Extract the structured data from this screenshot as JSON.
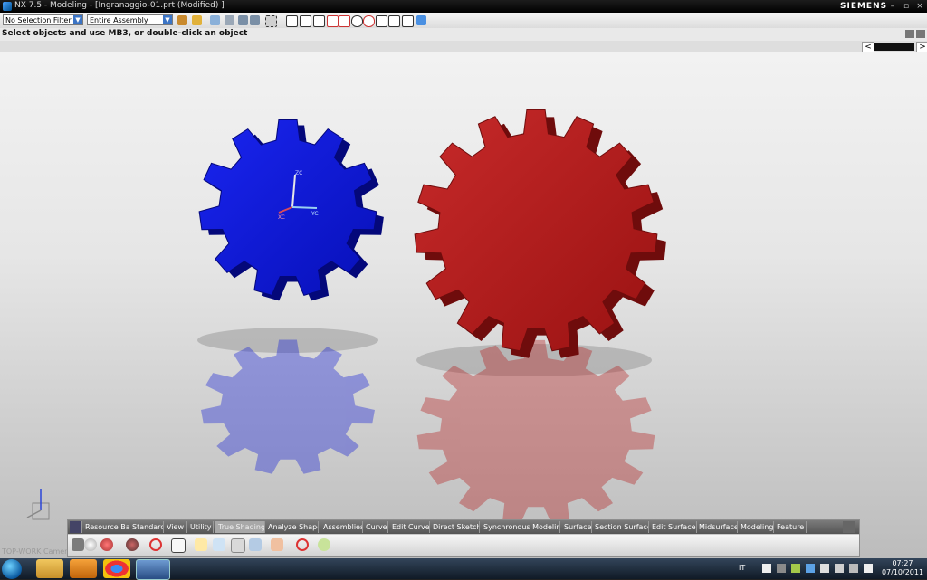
{
  "window": {
    "title": "NX 7.5 - Modeling - [Ingranaggio-01.prt (Modified) ]",
    "brand": "SIEMENS",
    "controls": [
      "–",
      "▫",
      "×"
    ]
  },
  "toolbar": {
    "selection_filter": "No Selection Filter",
    "scope": "Entire Assembly"
  },
  "prompt": {
    "message": "Select objects and use MB3, or double-click an object"
  },
  "viewport": {
    "wcs_labels": {
      "x": "XC",
      "y": "YC",
      "z": "ZC"
    },
    "gears": [
      {
        "name": "small-gear",
        "color": "#0a14d8",
        "teeth": 11
      },
      {
        "name": "large-gear",
        "color": "#b51515",
        "teeth": 15
      }
    ],
    "watermark": "TOP-WORK Camer"
  },
  "resource_bar": {
    "tabs": [
      "Resource Bar",
      "Standard",
      "View",
      "Utility",
      "True Shading",
      "Analyze Shape",
      "Assemblies",
      "Curve",
      "Edit Curve",
      "Direct Sketch",
      "Synchronous Modeling",
      "Surface",
      "Section Surface",
      "Edit Surface",
      "Midsurface",
      "Modeling",
      "Feature"
    ],
    "active_tab": "True Shading"
  },
  "taskbar": {
    "language": "IT",
    "time": "07:27",
    "date": "07/10/2011"
  }
}
